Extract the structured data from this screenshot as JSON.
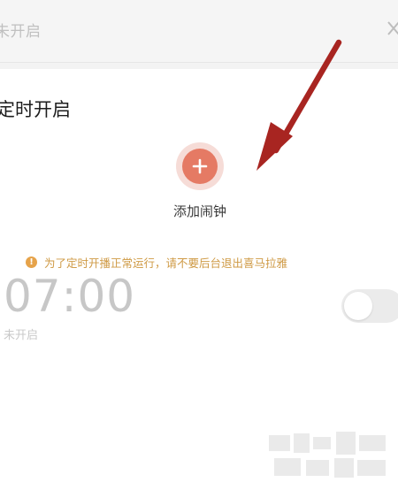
{
  "header": {
    "status_text": "未开启",
    "close_icon": "close-icon"
  },
  "card": {
    "title": "定时开启",
    "add_button_icon": "plus-icon",
    "add_label": "添加闹钟"
  },
  "notice": {
    "icon": "info-icon",
    "icon_glyph": "!",
    "text": "为了定时开播正常运行，请不要后台退出喜马拉雅"
  },
  "alarm": {
    "time": "07:00",
    "status": "未开启",
    "enabled": false
  },
  "colors": {
    "accent": "#e57a64",
    "notice": "#cf9a45",
    "arrow": "#b52a25"
  }
}
